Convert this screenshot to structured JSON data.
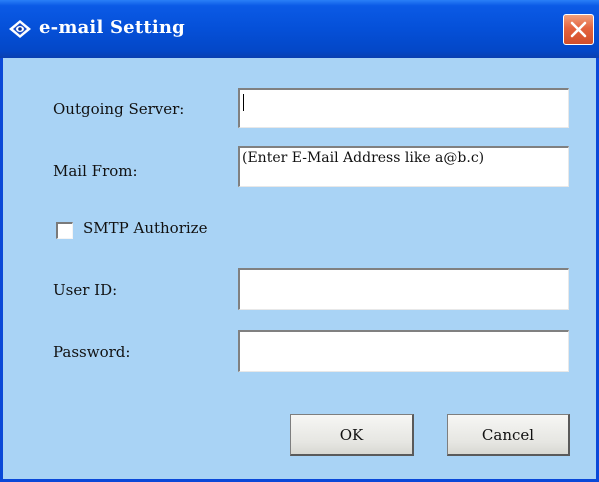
{
  "window": {
    "title": "e-mail Setting",
    "icon": "eye-diamond-icon",
    "close_icon": "close-x-icon"
  },
  "form": {
    "outgoing_server": {
      "label": "Outgoing Server:",
      "value": ""
    },
    "mail_from": {
      "label": "Mail From:",
      "value": "(Enter E-Mail Address like a@b.c)"
    },
    "smtp_authorize": {
      "label": "SMTP Authorize",
      "checked": false
    },
    "user_id": {
      "label": "User ID:",
      "value": ""
    },
    "password": {
      "label": "Password:",
      "value": ""
    }
  },
  "buttons": {
    "ok_label": "OK",
    "cancel_label": "Cancel"
  },
  "colors": {
    "titlebar": "#0550d8",
    "dialog_background": "#a9d3f5",
    "close_button": "#e4643f"
  }
}
